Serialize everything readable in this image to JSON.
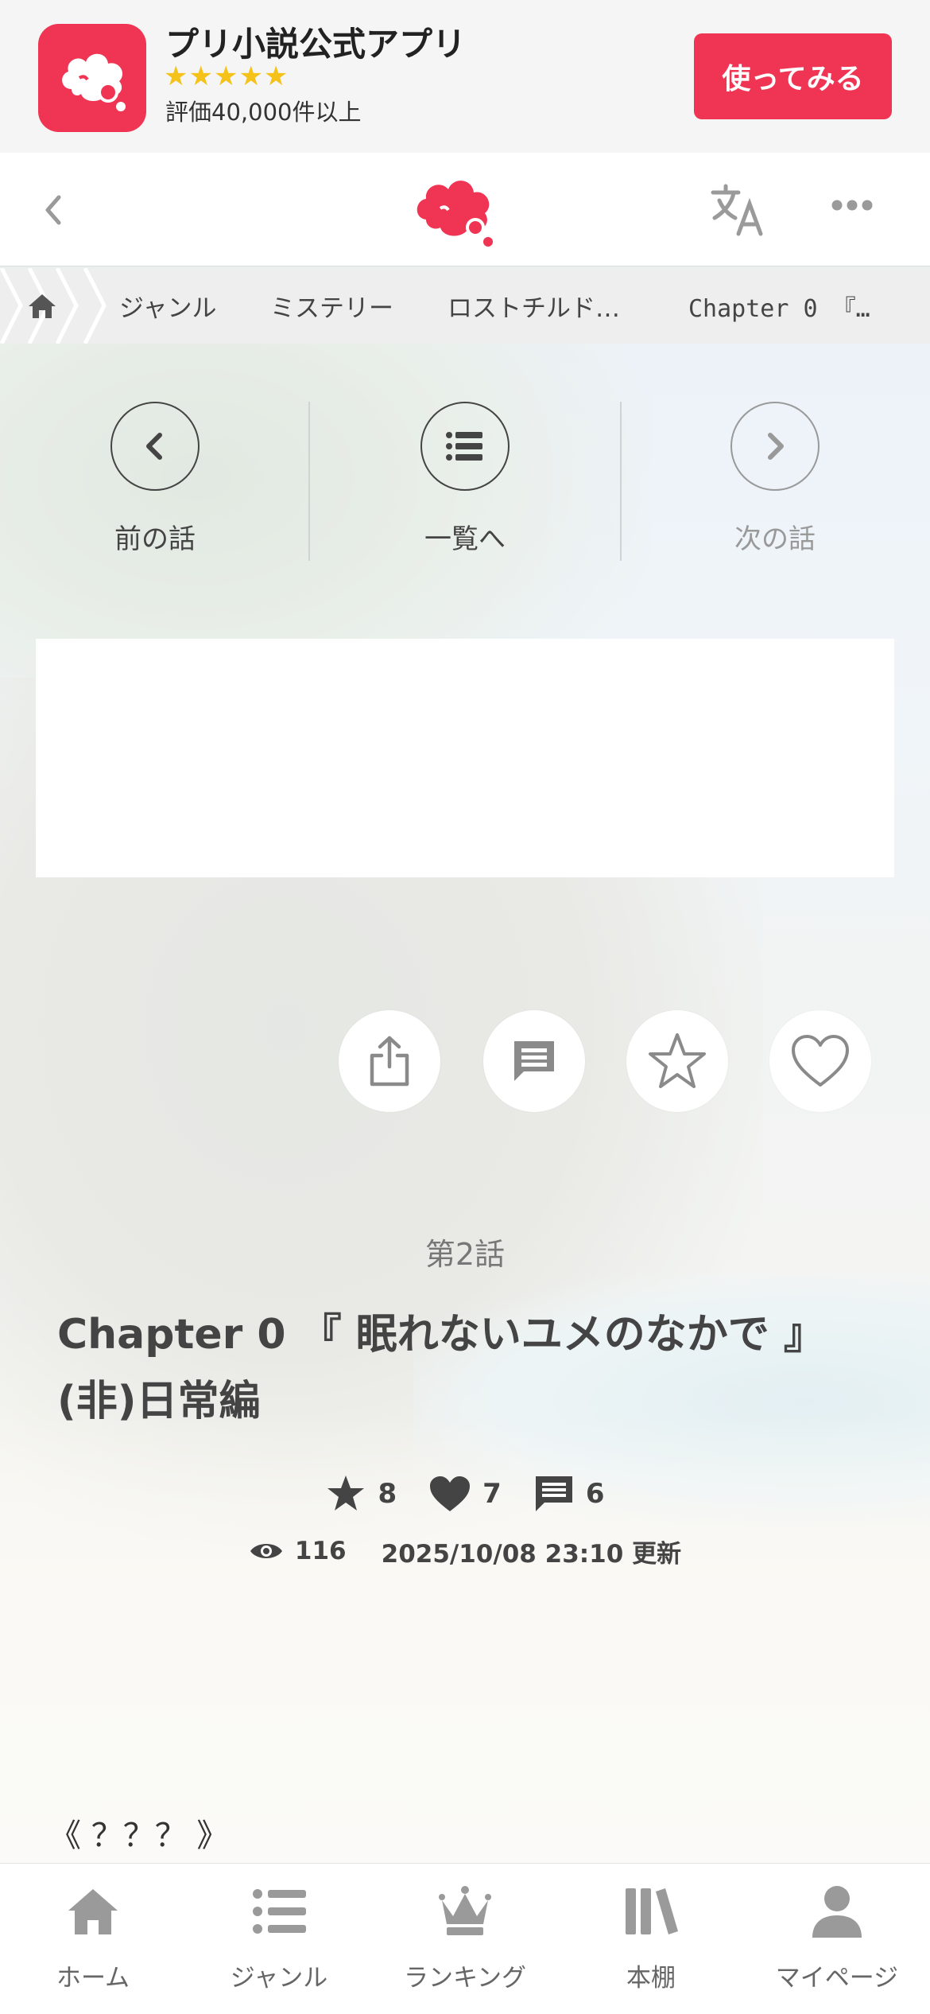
{
  "promo": {
    "app_name": "プリ小説公式アプリ",
    "stars": "★★★★★",
    "reviews": "評価40,000件以上",
    "cta": "使ってみる"
  },
  "header": {
    "back_icon": "chevron-left-icon",
    "logo_icon": "prichat-cloud-logo",
    "translate_icon": "translate-icon",
    "more_icon": "more-dots-icon"
  },
  "breadcrumb": {
    "home_icon": "home-icon",
    "items": [
      "ジャンル",
      "ミステリー",
      "ロストチルド…",
      "Chapter 0 『…"
    ]
  },
  "episode_nav": {
    "prev_label": "前の話",
    "list_label": "一覧へ",
    "next_label": "次の話"
  },
  "actions": [
    "share-icon",
    "comment-icon",
    "star-icon",
    "heart-icon"
  ],
  "episode": {
    "number": "第2話",
    "title": "Chapter 0 『 眠れないユメのなかで 』(非)日常編",
    "stars": "8",
    "likes": "7",
    "comments": "6",
    "views": "116",
    "updated": "2025/10/08 23:10 更新"
  },
  "body_start": "《 ？？？ 》",
  "tabbar": {
    "items": [
      "ホーム",
      "ジャンル",
      "ランキング",
      "本棚",
      "マイページ"
    ]
  },
  "colors": {
    "brand": "#ef3553",
    "star": "#f5c21a"
  }
}
